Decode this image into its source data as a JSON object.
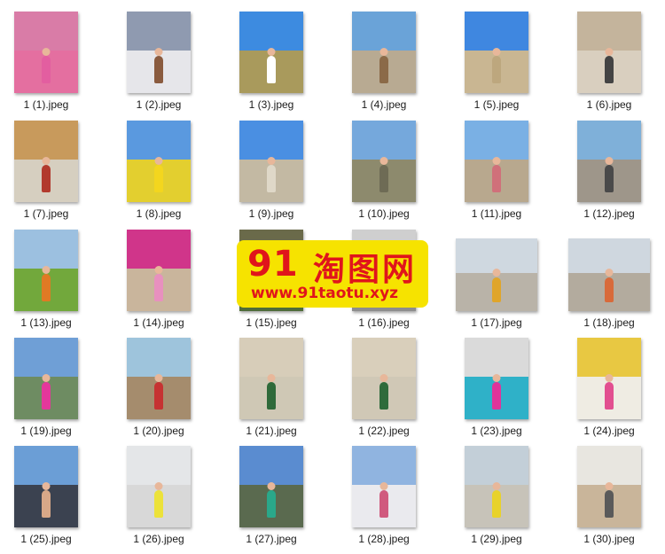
{
  "watermark": {
    "number": "91",
    "brand": "淘图网",
    "url": "www.91taotu.xyz"
  },
  "files": [
    {
      "name": "1 (1).jpeg",
      "orient": "portrait",
      "sky": "#d97ca7",
      "ground": "#e46fa0",
      "fig": "#e35ea0"
    },
    {
      "name": "1 (2).jpeg",
      "orient": "portrait",
      "sky": "#8f9ab0",
      "ground": "#e6e6ea",
      "fig": "#8a5b3f"
    },
    {
      "name": "1 (3).jpeg",
      "orient": "portrait",
      "sky": "#3d8be0",
      "ground": "#a99a5c",
      "fig": "#ffffff"
    },
    {
      "name": "1 (4).jpeg",
      "orient": "portrait",
      "sky": "#6aa3d8",
      "ground": "#b8aa92",
      "fig": "#8b6a48"
    },
    {
      "name": "1 (5).jpeg",
      "orient": "portrait",
      "sky": "#3f87e0",
      "ground": "#c9b692",
      "fig": "#bda77e"
    },
    {
      "name": "1 (6).jpeg",
      "orient": "portrait",
      "sky": "#c4b49c",
      "ground": "#d9cfbf",
      "fig": "#444444"
    },
    {
      "name": "1 (7).jpeg",
      "orient": "portrait",
      "sky": "#c89a5c",
      "ground": "#d6cfc0",
      "fig": "#b23a2d"
    },
    {
      "name": "1 (8).jpeg",
      "orient": "portrait",
      "sky": "#5a99df",
      "ground": "#e3cf2f",
      "fig": "#f3d61e"
    },
    {
      "name": "1 (9).jpeg",
      "orient": "portrait",
      "sky": "#4a8fe2",
      "ground": "#c3b9a3",
      "fig": "#dfd8c8"
    },
    {
      "name": "1 (10).jpeg",
      "orient": "portrait",
      "sky": "#75a8dc",
      "ground": "#8d8a6d",
      "fig": "#6e6b55"
    },
    {
      "name": "1 (11).jpeg",
      "orient": "portrait",
      "sky": "#7ab0e4",
      "ground": "#b8a88e",
      "fig": "#d0707a"
    },
    {
      "name": "1 (12).jpeg",
      "orient": "portrait",
      "sky": "#7fb0d9",
      "ground": "#9e968a",
      "fig": "#4a4a4a"
    },
    {
      "name": "1 (13).jpeg",
      "orient": "portrait",
      "sky": "#9cc0e0",
      "ground": "#72a83c",
      "fig": "#e07a24"
    },
    {
      "name": "1 (14).jpeg",
      "orient": "portrait",
      "sky": "#d0358a",
      "ground": "#c9b59c",
      "fig": "#e890bf"
    },
    {
      "name": "1 (15).jpeg",
      "orient": "portrait",
      "sky": "#6a6a4a",
      "ground": "#4f6c3a",
      "fig": "#333333"
    },
    {
      "name": "1 (16).jpeg",
      "orient": "portrait",
      "sky": "#cfcfcf",
      "ground": "#8d8d8d",
      "fig": "#555555"
    },
    {
      "name": "1 (17).jpeg",
      "orient": "landscape",
      "sky": "#cfd8e0",
      "ground": "#b9b3a8",
      "fig": "#e0a52a"
    },
    {
      "name": "1 (18).jpeg",
      "orient": "landscape",
      "sky": "#cfd7df",
      "ground": "#b3ab9e",
      "fig": "#d86a3a"
    },
    {
      "name": "1 (19).jpeg",
      "orient": "portrait",
      "sky": "#6f9fd6",
      "ground": "#6e8c62",
      "fig": "#e4379b"
    },
    {
      "name": "1 (20).jpeg",
      "orient": "portrait",
      "sky": "#9ec4dc",
      "ground": "#a58c6d",
      "fig": "#c63232"
    },
    {
      "name": "1 (21).jpeg",
      "orient": "portrait",
      "sky": "#d7cdb9",
      "ground": "#cfc8b5",
      "fig": "#2f6a3a"
    },
    {
      "name": "1 (22).jpeg",
      "orient": "portrait",
      "sky": "#d9cfbb",
      "ground": "#d0c8b6",
      "fig": "#2f6b3b"
    },
    {
      "name": "1 (23).jpeg",
      "orient": "portrait",
      "sky": "#dadada",
      "ground": "#2fb1c8",
      "fig": "#e0349a"
    },
    {
      "name": "1 (24).jpeg",
      "orient": "portrait",
      "sky": "#e8c842",
      "ground": "#efece3",
      "fig": "#e24f90"
    },
    {
      "name": "1 (25).jpeg",
      "orient": "portrait",
      "sky": "#6b9ed6",
      "ground": "#3b4250",
      "fig": "#d8a888"
    },
    {
      "name": "1 (26).jpeg",
      "orient": "portrait",
      "sky": "#e4e6e8",
      "ground": "#d8d8d8",
      "fig": "#ece23a"
    },
    {
      "name": "1 (27).jpeg",
      "orient": "portrait",
      "sky": "#5a8cd0",
      "ground": "#5a6a4f",
      "fig": "#2aa88a"
    },
    {
      "name": "1 (28).jpeg",
      "orient": "portrait",
      "sky": "#90b4e0",
      "ground": "#eaeaee",
      "fig": "#d05a7e"
    },
    {
      "name": "1 (29).jpeg",
      "orient": "portrait",
      "sky": "#c3cfd8",
      "ground": "#c7c3b9",
      "fig": "#e8d22a"
    },
    {
      "name": "1 (30).jpeg",
      "orient": "portrait",
      "sky": "#e8e6e0",
      "ground": "#c9b59a",
      "fig": "#5a5a5a"
    }
  ]
}
